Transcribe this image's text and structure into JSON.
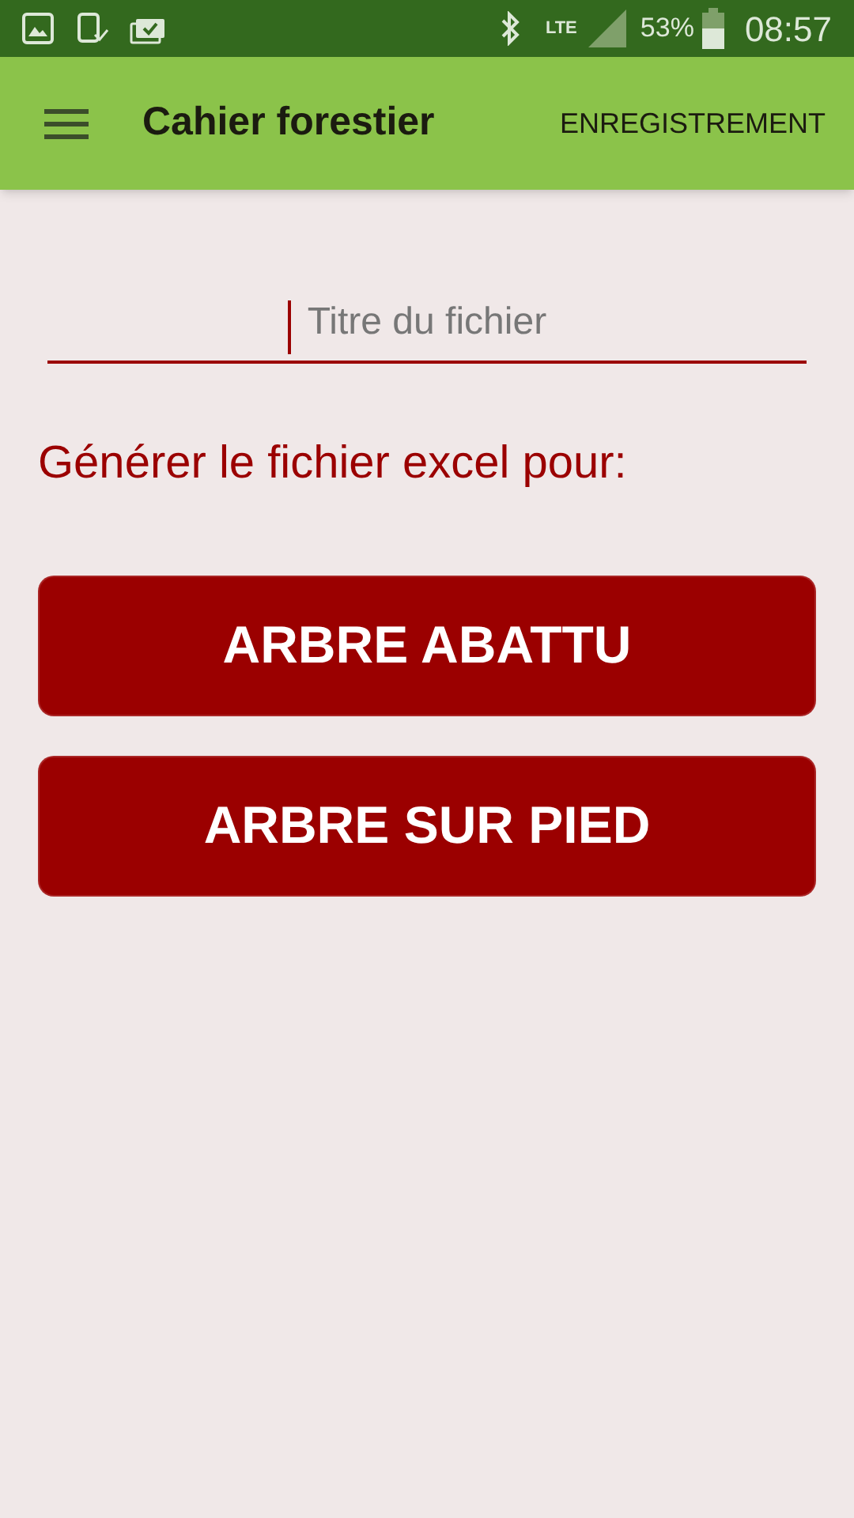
{
  "status_bar": {
    "network": "LTE",
    "battery": "53%",
    "time": "08:57"
  },
  "toolbar": {
    "title": "Cahier forestier",
    "action": "ENREGISTREMENT"
  },
  "file_field": {
    "placeholder": "Titre du fichier",
    "focused": true
  },
  "prompt": "Générer le fichier excel pour:",
  "buttons": [
    {
      "label": "ARBRE ABATTU"
    },
    {
      "label": "ARBRE SUR PIED"
    }
  ]
}
